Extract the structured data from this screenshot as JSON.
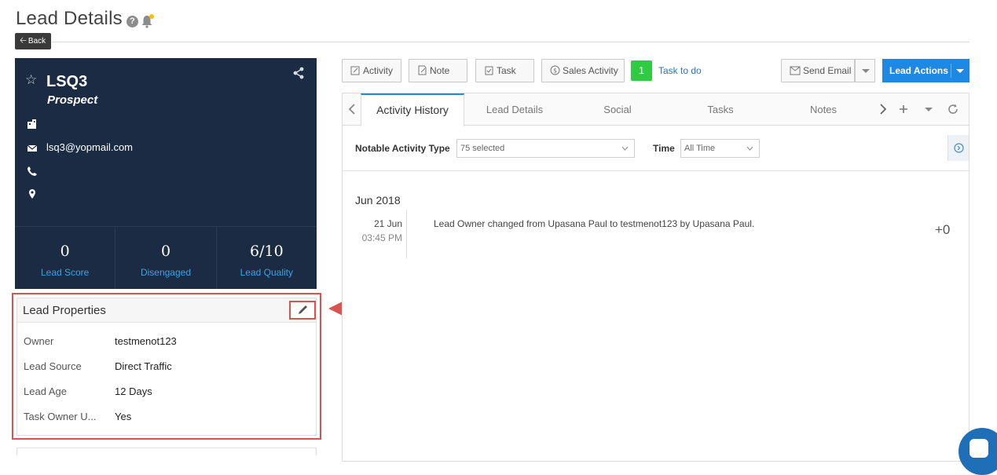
{
  "header": {
    "title": "Lead Details",
    "help_glyph": "?",
    "back_label": "Back"
  },
  "lead": {
    "name": "LSQ3",
    "stage": "Prospect",
    "email": "lsq3@yopmail.com",
    "metrics": [
      {
        "value": "0",
        "label": "Lead Score"
      },
      {
        "value": "0",
        "label": "Disengaged"
      },
      {
        "value": "6/10",
        "label": "Lead Quality"
      }
    ]
  },
  "properties": {
    "title": "Lead Properties",
    "rows": [
      {
        "label": "Owner",
        "value": "testmenot123"
      },
      {
        "label": "Lead Source",
        "value": "Direct Traffic"
      },
      {
        "label": "Lead Age",
        "value": "12 Days"
      },
      {
        "label": "Task Owner U...",
        "value": "Yes"
      }
    ]
  },
  "toolbar": {
    "activity": "Activity",
    "note": "Note",
    "task": "Task",
    "sales_activity": "Sales Activity",
    "todo_count": "1",
    "todo_label": "Task to do",
    "send_email": "Send Email",
    "lead_actions": "Lead Actions"
  },
  "tabs": [
    "Activity History",
    "Lead Details",
    "Social",
    "Tasks",
    "Notes"
  ],
  "filters": {
    "type_label": "Notable Activity Type",
    "type_value": "75 selected",
    "time_label": "Time",
    "time_value": "All Time"
  },
  "activity": {
    "month": "Jun 2018",
    "date": "21 Jun",
    "time": "03:45 PM",
    "text": "Lead Owner changed from Upasana Paul to testmenot123 by Upasana Paul.",
    "score": "+0"
  },
  "colors": {
    "card_bg": "#1b2b44",
    "accent": "#1e88e5",
    "link": "#3aa3e6",
    "annotation": "#d9534f",
    "todo_badge": "#2ecc40"
  }
}
